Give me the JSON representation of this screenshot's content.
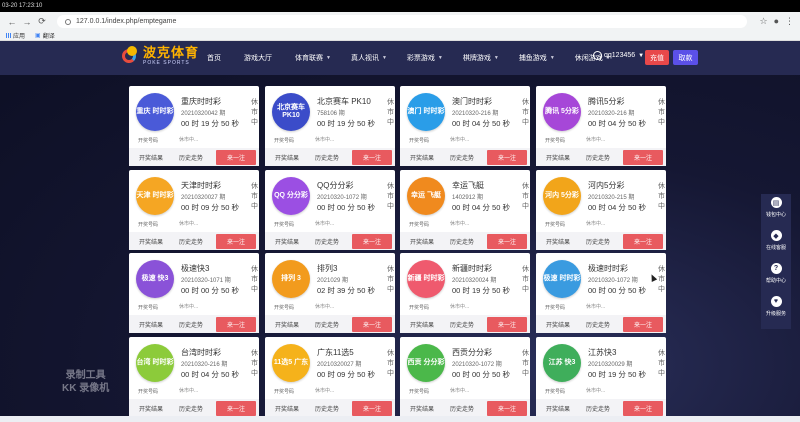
{
  "os_bar": {
    "datetime": "03-20 17:23:10"
  },
  "browser": {
    "url": "127.0.0.1/index.php/emptegame",
    "back": "←",
    "forward": "→",
    "reload": "⟳"
  },
  "bookmarks": [
    {
      "label": "应用"
    },
    {
      "label": "翻译"
    }
  ],
  "header": {
    "logo_cn": "波克体育",
    "logo_en": "POKE SPORTS",
    "nav": [
      {
        "label": "首页",
        "caret": ""
      },
      {
        "label": "游戏大厅",
        "caret": ""
      },
      {
        "label": "体育联赛",
        "caret": "▼"
      },
      {
        "label": "真人视讯",
        "caret": "▼"
      },
      {
        "label": "彩票游戏",
        "caret": "▼"
      },
      {
        "label": "棋牌游戏",
        "caret": "▼"
      },
      {
        "label": "捕鱼游戏",
        "caret": "▼"
      },
      {
        "label": "休闲游戏",
        "caret": "▼"
      }
    ],
    "username": "qq123456",
    "recharge": "充值",
    "withdraw": "取款"
  },
  "card_labels": {
    "num_label": "开奖号码",
    "status": "休市中...",
    "result": "开奖结果",
    "trend": "历史走势",
    "go": "来一注"
  },
  "cards": [
    {
      "logo": "重庆 时时彩",
      "name": "重庆时时彩",
      "period": "20210320042 期",
      "time": "00 时 19 分 50 秒",
      "status": "休市中",
      "color": "#4a5ad8"
    },
    {
      "logo": "北京赛车 PK10",
      "name": "北京赛车 PK10",
      "period": "758106 期",
      "time": "00 时 19 分 50 秒",
      "status": "休市中",
      "color": "#3b4cc9"
    },
    {
      "logo": "澳门 时时彩",
      "name": "澳门时时彩",
      "period": "20210320-216 期",
      "time": "00 时 04 分 50 秒",
      "status": "休市中",
      "color": "#2a9de8"
    },
    {
      "logo": "腾讯 5分彩",
      "name": "腾讯5分彩",
      "period": "20210320-216 期",
      "time": "00 时 04 分 50 秒",
      "status": "休市中",
      "color": "#a647d8"
    },
    {
      "logo": "天津 时时彩",
      "name": "天津时时彩",
      "period": "20210320027 期",
      "time": "00 时 09 分 50 秒",
      "status": "休市中",
      "color": "#f5a623"
    },
    {
      "logo": "QQ 分分彩",
      "name": "QQ分分彩",
      "period": "20210320-1072 期",
      "time": "00 时 00 分 50 秒",
      "status": "休市中",
      "color": "#9b4fe3"
    },
    {
      "logo": "幸运 飞艇",
      "name": "幸运飞艇",
      "period": "1402912 期",
      "time": "00 时 04 分 50 秒",
      "status": "休市中",
      "color": "#f08a1e"
    },
    {
      "logo": "河内 5分彩",
      "name": "河内5分彩",
      "period": "20210320-215 期",
      "time": "00 时 04 分 50 秒",
      "status": "休市中",
      "color": "#f2a51a"
    },
    {
      "logo": "极速 快3",
      "name": "极速快3",
      "period": "20210320-1071 期",
      "time": "00 时 00 分 50 秒",
      "status": "休市中",
      "color": "#8a52d8"
    },
    {
      "logo": "排列 3",
      "name": "排列3",
      "period": "2021029 期",
      "time": "02 时 39 分 50 秒",
      "status": "休市中",
      "color": "#f29b1d"
    },
    {
      "logo": "新疆 时时彩",
      "name": "新疆时时彩",
      "period": "20210320024 期",
      "time": "00 时 19 分 50 秒",
      "status": "休市中",
      "color": "#ef5a6e"
    },
    {
      "logo": "极速 时时彩",
      "name": "极速时时彩",
      "period": "20210320-1072 期",
      "time": "00 时 00 分 50 秒",
      "status": "休市中",
      "color": "#3a9be0"
    },
    {
      "logo": "台湾 时时彩",
      "name": "台湾时时彩",
      "period": "20210320-216 期",
      "time": "00 时 04 分 50 秒",
      "status": "休市中",
      "color": "#8ccb3a"
    },
    {
      "logo": "11选5 广东",
      "name": "广东11选5",
      "period": "20210320027 期",
      "time": "00 时 09 分 50 秒",
      "status": "休市中",
      "color": "#f5b21b"
    },
    {
      "logo": "西贡 分分彩",
      "name": "西贡分分彩",
      "period": "20210320-1072 期",
      "time": "00 时 00 分 50 秒",
      "status": "休市中",
      "color": "#4bb84a"
    },
    {
      "logo": "江苏 快3",
      "name": "江苏快3",
      "period": "20210320029 期",
      "time": "00 时 19 分 50 秒",
      "status": "休市中",
      "color": "#3fae5b"
    }
  ],
  "sidebar": [
    {
      "icon": "▤",
      "label": "钱包中心"
    },
    {
      "icon": "◆",
      "label": "在线客服"
    },
    {
      "icon": "?",
      "label": "帮助中心"
    },
    {
      "icon": "♥",
      "label": "升级服务"
    }
  ],
  "watermark": {
    "line1": "录制工具",
    "line2": "KK 录像机"
  }
}
